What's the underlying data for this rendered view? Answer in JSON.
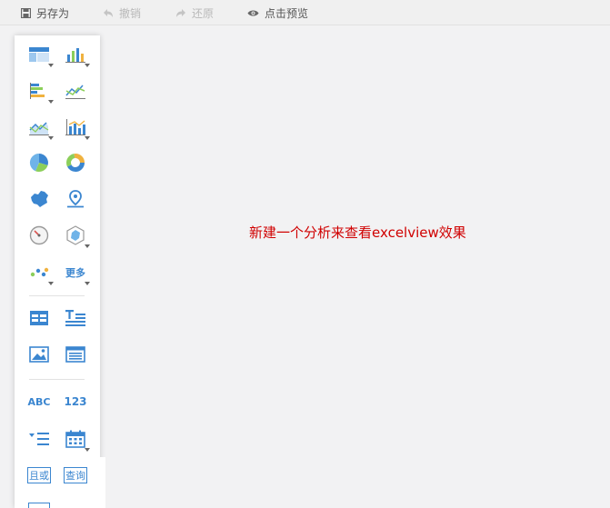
{
  "toolbar": {
    "save_as": "另存为",
    "undo": "撤销",
    "redo": "还原",
    "preview": "点击预览"
  },
  "palette": {
    "more_label": "更多",
    "abc_label": "ABC",
    "num_label": "123",
    "and_or_label": "且或",
    "query_label": "查询"
  },
  "canvas": {
    "message": "新建一个分析来查看excelview效果"
  },
  "colors": {
    "message": "#d00000",
    "icon_blue": "#3b86d0"
  }
}
